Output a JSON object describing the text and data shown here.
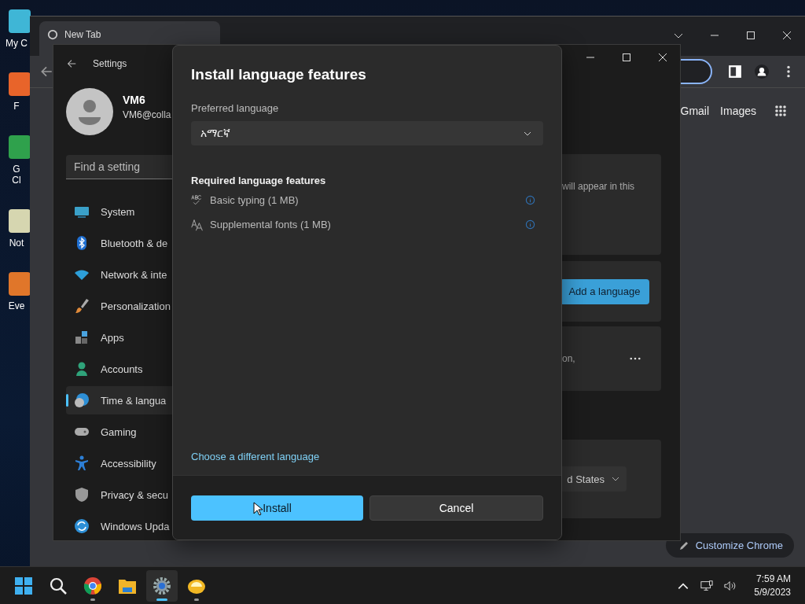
{
  "desktop_icons": [
    {
      "kind": "computer",
      "lines": [
        "My C"
      ]
    },
    {
      "kind": "firefox",
      "lines": [
        "F"
      ]
    },
    {
      "kind": "chrome",
      "lines": [
        "G",
        "Cl"
      ]
    },
    {
      "kind": "notepad",
      "lines": [
        "Not"
      ]
    },
    {
      "kind": "app",
      "lines": [
        "Eve"
      ]
    }
  ],
  "chrome": {
    "tab": {
      "title": "New Tab"
    },
    "links": [
      "Gmail",
      "Images"
    ],
    "customize_button": "Customize Chrome"
  },
  "settings": {
    "title": "Settings",
    "account": {
      "name": "VM6",
      "email": "VM6@colla"
    },
    "search": {
      "placeholder": "Find a setting"
    },
    "nav": [
      {
        "kind": "system",
        "label": "System",
        "selected": false
      },
      {
        "kind": "bluetooth",
        "label": "Bluetooth & de",
        "selected": false
      },
      {
        "kind": "network",
        "label": "Network & inte",
        "selected": false
      },
      {
        "kind": "personalization",
        "label": "Personalization",
        "selected": false
      },
      {
        "kind": "apps",
        "label": "Apps",
        "selected": false
      },
      {
        "kind": "accounts",
        "label": "Accounts",
        "selected": false
      },
      {
        "kind": "time",
        "label": "Time & langua",
        "selected": true
      },
      {
        "kind": "gaming",
        "label": "Gaming",
        "selected": false
      },
      {
        "kind": "accessibility",
        "label": "Accessibility",
        "selected": false
      },
      {
        "kind": "privacy",
        "label": "Privacy & secu",
        "selected": false
      },
      {
        "kind": "update",
        "label": "Windows Upda",
        "selected": false
      }
    ],
    "content": {
      "note": "will appear in this",
      "add_button": "Add a language",
      "language_card_text": "on,",
      "region_value": "d States"
    }
  },
  "dialog": {
    "title": "Install language features",
    "preferred_label": "Preferred language",
    "language_value": "አማርኛ",
    "features_heading": "Required language features",
    "features": [
      {
        "kind": "typing",
        "label": "Basic typing (1 MB)"
      },
      {
        "kind": "fonts",
        "label": "Supplemental fonts (1 MB)"
      }
    ],
    "link": "Choose a different language",
    "buttons": [
      {
        "kind": "primary",
        "label": "Install"
      },
      {
        "kind": "secondary",
        "label": "Cancel"
      }
    ]
  },
  "taskbar": {
    "apps": [
      {
        "kind": "start",
        "running": false,
        "selected": false
      },
      {
        "kind": "search",
        "running": false,
        "selected": false
      },
      {
        "kind": "chrome",
        "running": true,
        "selected": false
      },
      {
        "kind": "files",
        "running": false,
        "selected": false
      },
      {
        "kind": "settings",
        "running": true,
        "selected": true
      },
      {
        "kind": "fruit",
        "running": true,
        "selected": false
      }
    ],
    "time": "7:59 AM",
    "date": "5/9/2023"
  }
}
